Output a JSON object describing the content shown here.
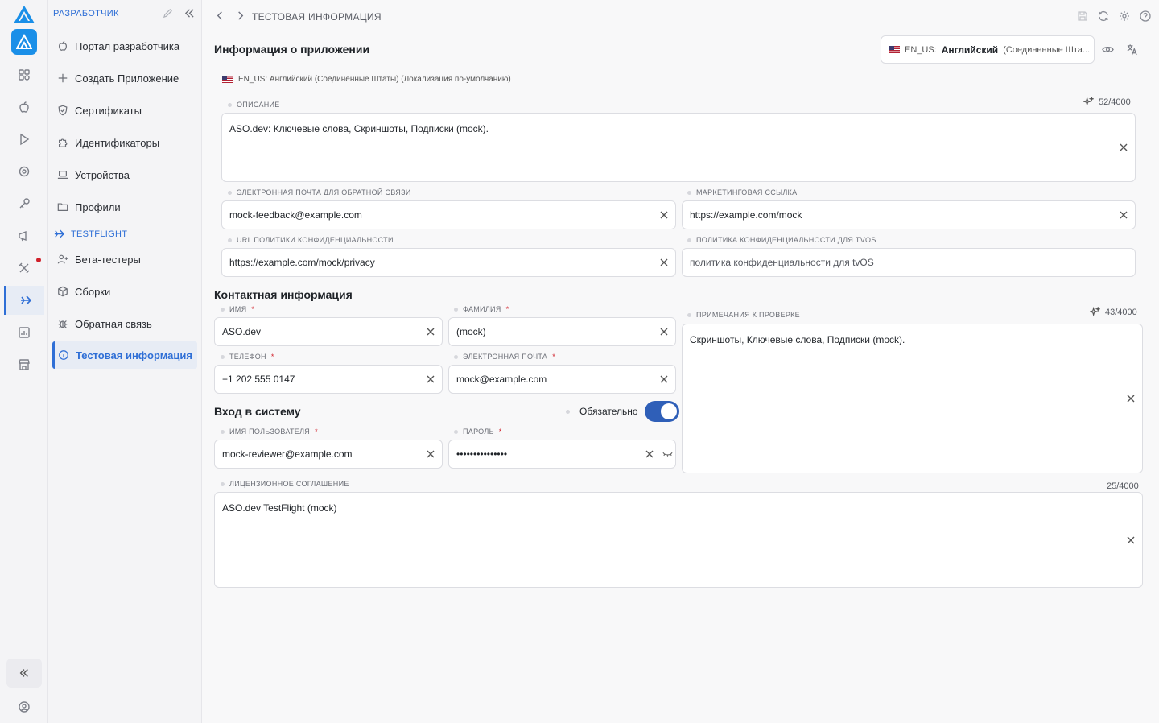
{
  "sidebar": {
    "header": "РАЗРАБОТЧИК",
    "items": [
      {
        "label": "Портал разработчика",
        "icon": "apple-icon"
      },
      {
        "label": "Создать Приложение",
        "icon": "plus-icon"
      },
      {
        "label": "Сертификаты",
        "icon": "shield-icon"
      },
      {
        "label": "Идентификаторы",
        "icon": "puzzle-icon"
      },
      {
        "label": "Устройства",
        "icon": "laptop-icon"
      },
      {
        "label": "Профили",
        "icon": "folder-icon"
      }
    ],
    "section": "TESTFLIGHT",
    "testflight_items": [
      {
        "label": "Бета-тестеры",
        "icon": "users-icon"
      },
      {
        "label": "Сборки",
        "icon": "cube-icon"
      },
      {
        "label": "Обратная связь",
        "icon": "bug-icon"
      },
      {
        "label": "Тестовая информация",
        "icon": "info-icon"
      }
    ]
  },
  "topbar": {
    "breadcrumb": "ТЕСТОВАЯ ИНФОРМАЦИЯ"
  },
  "app_info": {
    "title": "Информация о приложении",
    "locale_code": "EN_US:",
    "locale_name": "Английский",
    "locale_region": "(Соединенные Шта...",
    "locale_note": "EN_US: Английский (Соединенные Штаты) (Локализация по-умолчанию)",
    "description": {
      "label": "ОПИСАНИЕ",
      "value": "ASO.dev: Ключевые слова, Скриншоты, Подписки (mock).",
      "counter": "52/4000"
    },
    "feedback_email": {
      "label": "ЭЛЕКТРОННАЯ ПОЧТА ДЛЯ ОБРАТНОЙ СВЯЗИ",
      "value": "mock-feedback@example.com"
    },
    "marketing_url": {
      "label": "МАРКЕТИНГОВАЯ ССЫЛКА",
      "value": "https://example.com/mock"
    },
    "privacy_url": {
      "label": "URL ПОЛИТИКИ КОНФИДЕНЦИАЛЬНОСТИ",
      "value": "https://example.com/mock/privacy"
    },
    "tvos_privacy": {
      "label": "ПОЛИТИКА КОНФИДЕНЦИАЛЬНОСТИ ДЛЯ TVOS",
      "placeholder": "политика конфиденциальности для tvOS"
    }
  },
  "contact": {
    "title": "Контактная информация",
    "first_name": {
      "label": "ИМЯ",
      "value": "ASO.dev"
    },
    "last_name": {
      "label": "ФАМИЛИЯ",
      "value": "(mock)"
    },
    "phone": {
      "label": "ТЕЛЕФОН",
      "value": "+1 202 555 0147"
    },
    "email": {
      "label": "ЭЛЕКТРОННАЯ ПОЧТА",
      "value": "mock@example.com"
    },
    "review_notes": {
      "label": "ПРИМЕЧАНИЯ К ПРОВЕРКЕ",
      "value": "Скриншоты, Ключевые слова, Подписки (mock).",
      "counter": "43/4000"
    }
  },
  "signin": {
    "title": "Вход в систему",
    "required_label": "Обязательно",
    "required_on": true,
    "username": {
      "label": "ИМЯ ПОЛЬЗОВАТЕЛЯ",
      "value": "mock-reviewer@example.com"
    },
    "password": {
      "label": "ПАРОЛЬ",
      "value": "•••••••••••••••"
    }
  },
  "license": {
    "label": "ЛИЦЕНЗИОННОЕ СОГЛАШЕНИЕ",
    "value": "ASO.dev TestFlight (mock)",
    "counter": "25/4000"
  },
  "required_mark": "*",
  "colors": {
    "accent": "#2f6fd6",
    "toggle": "#2f5fb8",
    "required": "#d0202a"
  }
}
